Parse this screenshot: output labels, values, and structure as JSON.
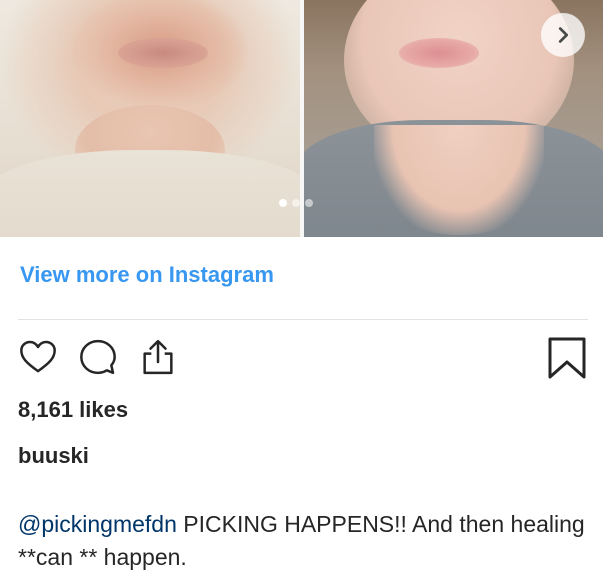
{
  "post": {
    "view_more": "View more on Instagram",
    "likes": "8,161 likes",
    "username": "buuski",
    "caption": {
      "mention": "@pickingmefdn",
      "text": " PICKING HAPPENS!! And then healing **can ** happen."
    },
    "carousel": {
      "slide_count": 3,
      "active_index": 0
    }
  },
  "icons": {
    "next": "chevron-right-icon",
    "like": "heart-icon",
    "comment": "comment-icon",
    "share": "share-icon",
    "save": "bookmark-icon"
  },
  "colors": {
    "link": "#3897f0",
    "mention": "#003569",
    "text": "#262626"
  }
}
